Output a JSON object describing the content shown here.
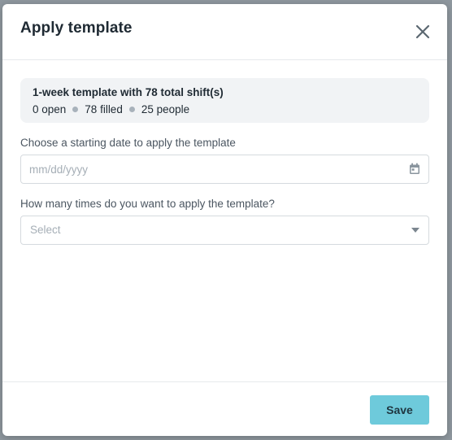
{
  "modal": {
    "title": "Apply template",
    "close_icon": "close-icon"
  },
  "summary": {
    "title": "1-week template with 78 total shift(s)",
    "open": "0 open",
    "filled": "78 filled",
    "people": "25 people",
    "dot_color": "#a8b2bb"
  },
  "date_field": {
    "label": "Choose a starting date to apply the template",
    "placeholder": "mm/dd/yyyy",
    "icon": "calendar-icon"
  },
  "repeat_field": {
    "label": "How many times do you want to apply the template?",
    "placeholder": "Select",
    "icon": "chevron-down-icon"
  },
  "footer": {
    "save_label": "Save",
    "save_color": "#6ecadb"
  }
}
